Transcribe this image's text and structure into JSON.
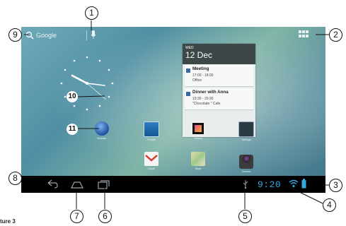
{
  "search": {
    "label": "Google"
  },
  "calendar": {
    "day": "WED",
    "date": "12 Dec",
    "events": [
      {
        "title": "Meeting",
        "time": "17:00 - 18:00",
        "location": "Office"
      },
      {
        "title": "Dinner with Anna",
        "time": "19:30 - 20:30",
        "location": "\"Chocolate \" Cafe"
      }
    ]
  },
  "apps": [
    {
      "label": "Browser",
      "icon": "globe-icon"
    },
    {
      "label": "People",
      "icon": "people-icon"
    },
    {
      "label": "Gallery",
      "icon": "gallery-icon"
    },
    {
      "label": "Settings",
      "icon": "settings-icon"
    },
    {
      "label": "Gmail",
      "icon": "gmail-icon"
    },
    {
      "label": "Maps",
      "icon": "maps-icon"
    },
    {
      "label": "Camera",
      "icon": "camera-icon"
    }
  ],
  "status": {
    "time": "9:20"
  },
  "callouts": [
    "1",
    "2",
    "3",
    "4",
    "5",
    "6",
    "7",
    "8",
    "9",
    "10",
    "11"
  ],
  "figure_caption": "ture 3",
  "colors": {
    "accent": "#31a8de",
    "navbar": "#000000",
    "calendar_header": "#3d4748",
    "event_marker": "#3b66a8"
  }
}
